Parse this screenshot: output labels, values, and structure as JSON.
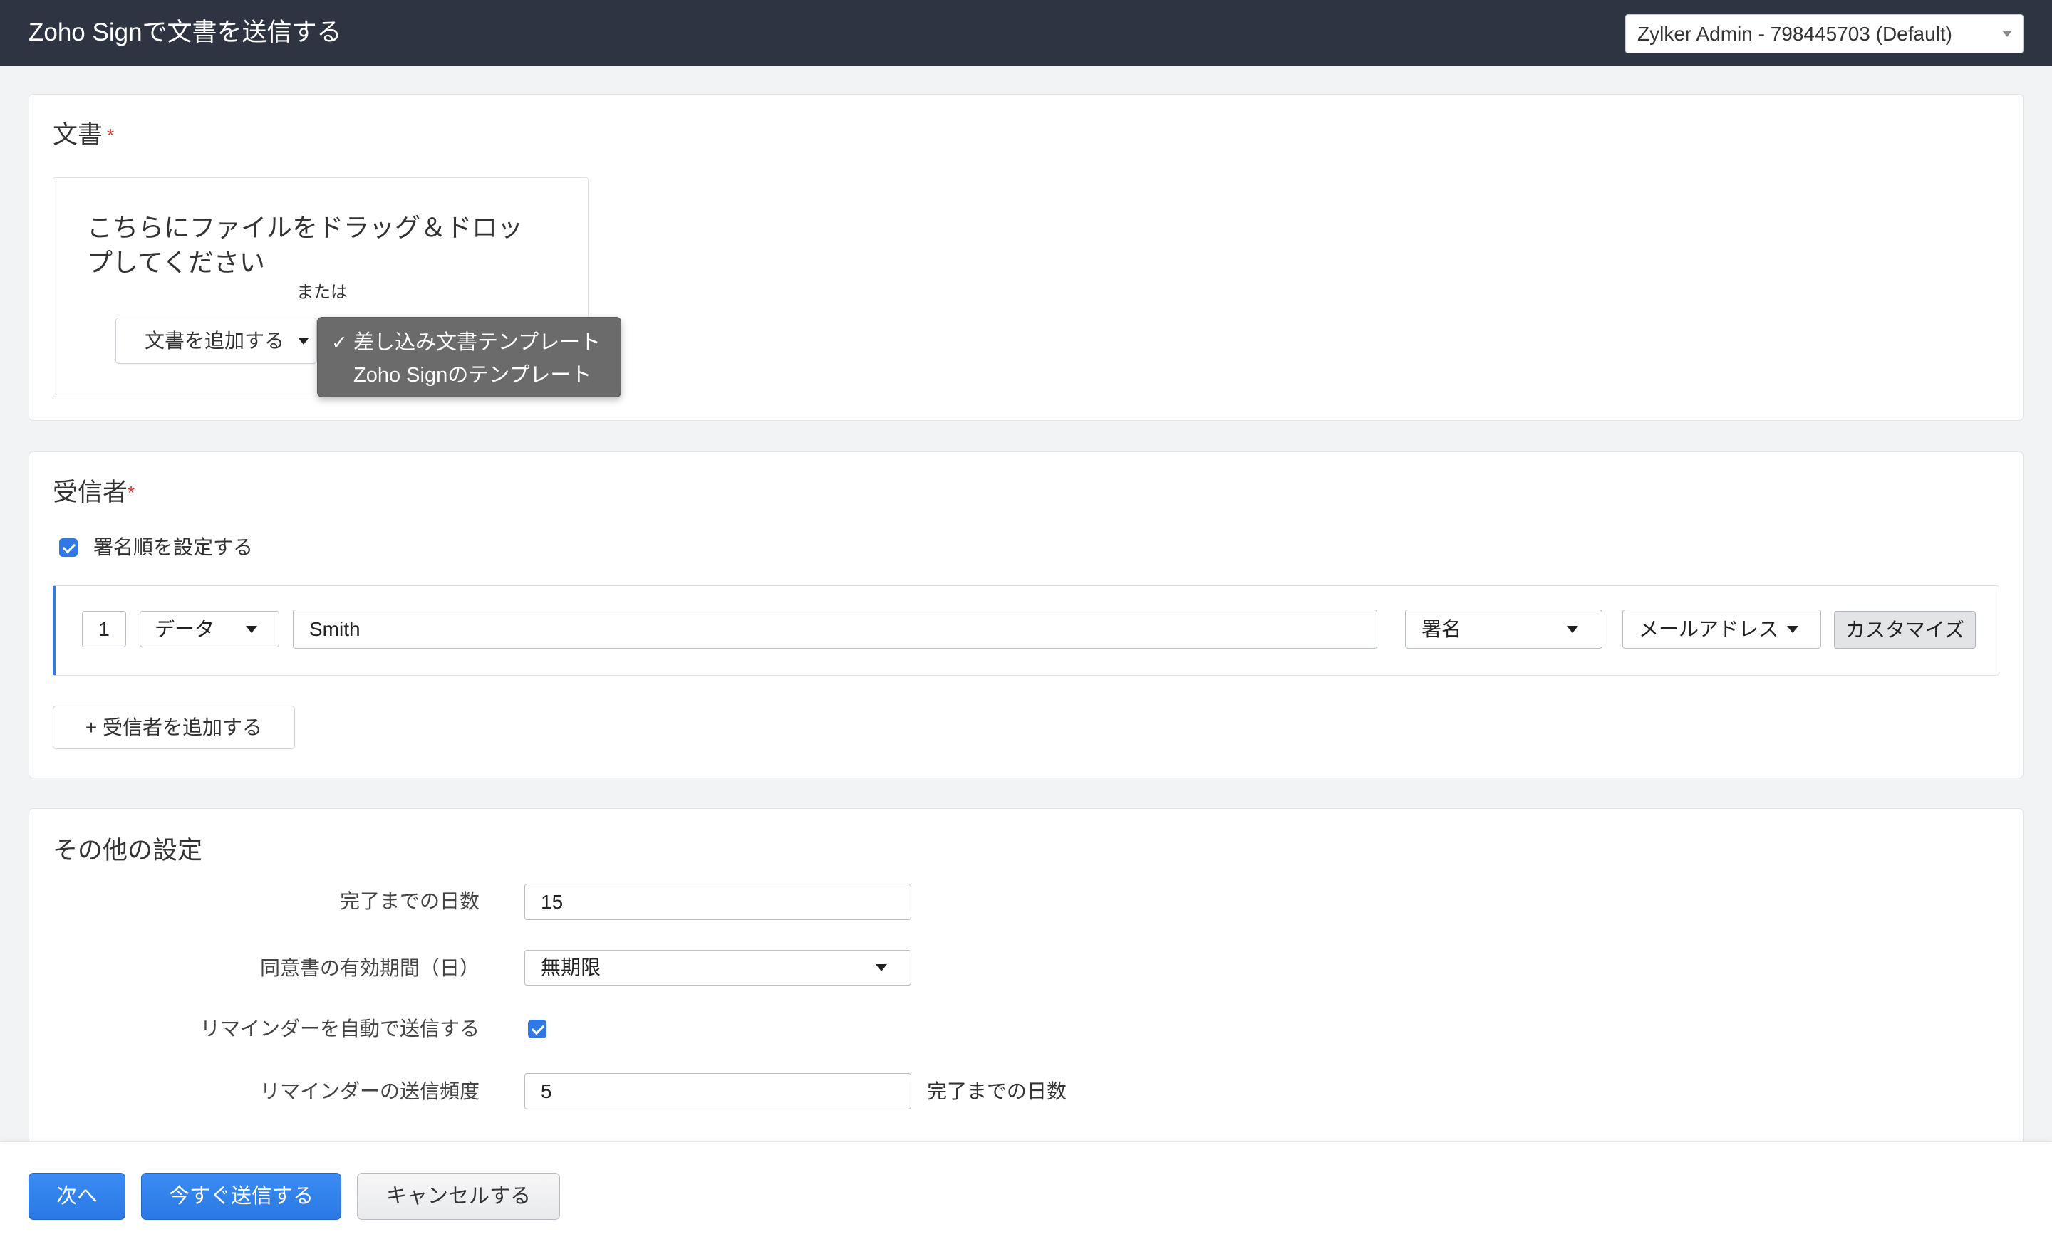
{
  "header": {
    "title": "Zoho Signで文書を送信する",
    "account_select": "Zylker Admin - 798445703 (Default)"
  },
  "documents": {
    "title": "文書",
    "required_mark": "*",
    "dropzone_text": "こちらにファイルをドラッグ＆ドロップしてください",
    "or_text": "または",
    "add_button": "文書を追加する",
    "menu": [
      {
        "label": "差し込み文書テンプレート",
        "checked": true
      },
      {
        "label": "Zoho Signのテンプレート",
        "checked": false
      }
    ]
  },
  "recipients": {
    "title": "受信者",
    "required_mark": "*",
    "signing_order_label": "署名順を設定する",
    "signing_order_checked": true,
    "rows": [
      {
        "order": "1",
        "type": "データ",
        "name": "Smith",
        "action": "署名",
        "delivery": "メールアドレス",
        "customize": "カスタマイズ"
      }
    ],
    "add_button": "+ 受信者を追加する"
  },
  "other_settings": {
    "title": "その他の設定",
    "days_to_complete": {
      "label": "完了までの日数",
      "value": "15"
    },
    "consent_validity": {
      "label": "同意書の有効期間（日）",
      "value": "無期限"
    },
    "auto_reminder": {
      "label": "リマインダーを自動で送信する",
      "checked": true
    },
    "reminder_frequency": {
      "label": "リマインダーの送信頻度",
      "value": "5",
      "suffix": "完了までの日数"
    }
  },
  "footer": {
    "next": "次へ",
    "send_now": "今すぐ送信する",
    "cancel": "キャンセルする"
  },
  "colors": {
    "header_bg": "#2f3442",
    "primary": "#2f84ee",
    "required": "#e0322f",
    "row_accent": "#3a78d8",
    "menu_bg": "#6b6b6b"
  },
  "icons": [
    "caret-down-icon",
    "check-icon",
    "checkbox"
  ]
}
